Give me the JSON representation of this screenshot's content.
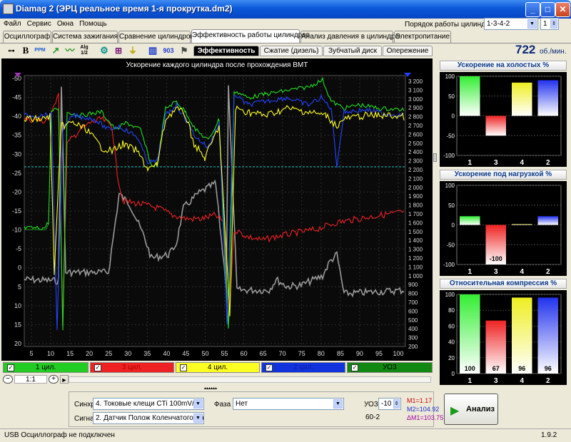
{
  "window": {
    "title": "Diamag 2 (ЭРЦ реальное время 1-я прокрутка.dm2)",
    "btn_min": "_",
    "btn_max": "□",
    "btn_close": "✕"
  },
  "menu": [
    "Файл",
    "Сервис",
    "Окна",
    "Помощь"
  ],
  "cylinder_order": {
    "label": "Порядок работы цилиндров",
    "value": "1-3-4-2",
    "spin": "1"
  },
  "tabs": [
    {
      "label": "Осциллограф",
      "color": "#7ea8e8"
    },
    {
      "label": "Система зажигания",
      "color": "#f6a6a6"
    },
    {
      "label": "Сравнение цилиндров",
      "color": "#a6e6a6"
    },
    {
      "label": "Эффективность работы цилиндров",
      "color": "#ffffff"
    },
    {
      "label": "Анализ давления в цилиндре",
      "color": "#f6e98c"
    },
    {
      "label": "Электропитание",
      "color": "#f0a6e0"
    }
  ],
  "toolbar": {
    "b": "B",
    "ppm": "PPM",
    "alg": "Alg 1/2",
    "ref": "903"
  },
  "subtabs": [
    "Эффективность",
    "Сжатие (дизель)",
    "Зубчатый диск",
    "Опережение"
  ],
  "rpm": {
    "value": "722",
    "unit": "об./мин."
  },
  "chart": {
    "title": "Ускорение каждого цилиндра после прохождения ВМТ",
    "left_ticks": [
      "-50",
      "-45",
      "-40",
      "-35",
      "-30",
      "-25",
      "-20",
      "-15",
      "-10",
      "-5",
      "0",
      "5",
      "10",
      "15",
      "20"
    ],
    "right_ticks": [
      "3 200",
      "3 100",
      "3 000",
      "2 900",
      "2 800",
      "2 700",
      "2 600",
      "2 500",
      "2 400",
      "2 300",
      "2 200",
      "2 100",
      "2 000",
      "1 900",
      "1 800",
      "1 700",
      "1 600",
      "1 500",
      "1 400",
      "1 300",
      "1 200",
      "1 100",
      "1 000",
      "900",
      "800",
      "700",
      "600",
      "500",
      "400",
      "300",
      "200"
    ],
    "x_ticks": [
      "5",
      "10",
      "15",
      "20",
      "25",
      "30",
      "35",
      "40",
      "45",
      "50",
      "55",
      "60",
      "65",
      "70",
      "75",
      "80",
      "85",
      "90",
      "95",
      "100"
    ]
  },
  "chart_data": [
    {
      "type": "bar",
      "title": "Ускорение на холостых %",
      "categories": [
        "1",
        "3",
        "4",
        "2"
      ],
      "values": [
        100,
        -50,
        84,
        90
      ],
      "colors": [
        "#33ee33",
        "#ee2222",
        "#eeee22",
        "#2233ee"
      ],
      "ylim": [
        -100,
        100
      ],
      "y_ticks": [
        "100",
        "50",
        "0",
        "-50",
        "-100"
      ]
    },
    {
      "type": "bar",
      "title": "Ускорение под нагрузкой %",
      "categories": [
        "1",
        "3",
        "4",
        "2"
      ],
      "values": [
        22,
        -100,
        2,
        22
      ],
      "labels": [
        "",
        "-100",
        "",
        ""
      ],
      "colors": [
        "#33ee33",
        "#ee2222",
        "#eeee22",
        "#2233ee"
      ],
      "ylim": [
        -100,
        100
      ],
      "y_ticks": [
        "100",
        "50",
        "0",
        "-50",
        "-100"
      ]
    },
    {
      "type": "bar",
      "title": "Относительная компрессия %",
      "categories": [
        "1",
        "3",
        "4",
        "2"
      ],
      "values": [
        100,
        67,
        96,
        96
      ],
      "labels": [
        "100",
        "67",
        "96",
        "96"
      ],
      "colors": [
        "#33ee33",
        "#ee2222",
        "#eeee22",
        "#2233ee"
      ],
      "ylim": [
        0,
        100
      ],
      "y_ticks": [
        "100",
        "80",
        "60",
        "40",
        "20",
        "0"
      ]
    }
  ],
  "legend": [
    {
      "label": "1 цил.",
      "color": "#22cc22",
      "text": "#000"
    },
    {
      "label": "3 цил.",
      "color": "#ee2222",
      "text": "#c00000"
    },
    {
      "label": "4 цил.",
      "color": "#ffff22",
      "text": "#000"
    },
    {
      "label": "2 цил.",
      "color": "#1133dd",
      "text": "#0b1fa0"
    },
    {
      "label": "УОЗ",
      "color": "#118811",
      "text": "#000"
    }
  ],
  "zoom": "1:1",
  "controls": {
    "sync_label": "Синхро:",
    "sync_value": "4. Токовые клещи CTi 100mV/A",
    "signal_label": "Сигнал:",
    "signal_value": "2. Датчик Полож Коленчатого Вал",
    "phase_label": "Фаза",
    "phase_value": "Нет",
    "uoz_label": "УОЗ",
    "uoz_value": "-10",
    "disk": "60-2",
    "m1": "М1=1.17",
    "m2": "М2=104.92",
    "dm": "ΔM1=103.75",
    "analyze": "Анализ"
  },
  "status": {
    "text": "USB Осциллограф не подключен",
    "version": "1.9.2"
  }
}
